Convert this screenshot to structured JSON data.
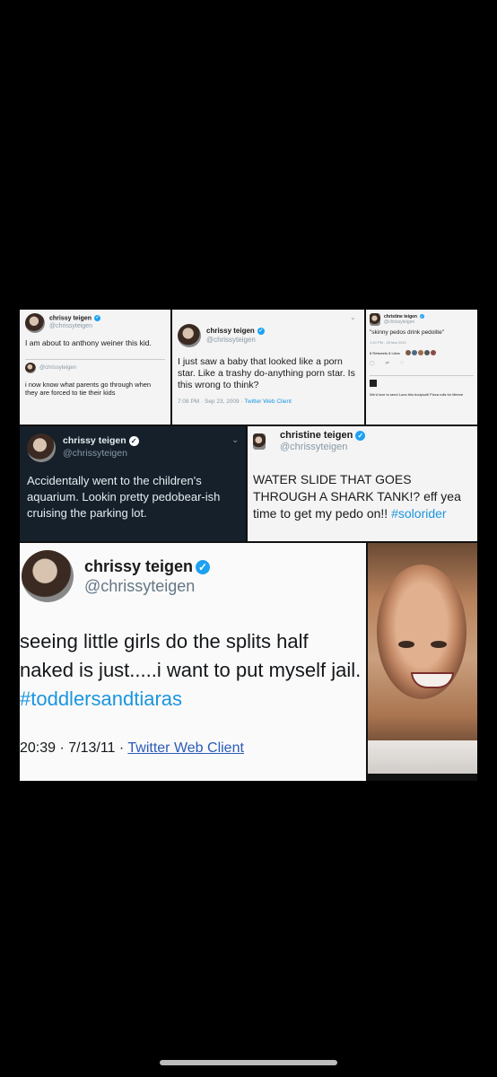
{
  "tweets": {
    "t1": {
      "name": "chrissy teigen",
      "handle": "@chrissyteigen",
      "text": "I am about to anthony weiner this kid.",
      "sub_handle": "@chrissyteigen",
      "sub_text": "i now know what parents go through when they are forced to tie their kids"
    },
    "t2": {
      "name": "chrissy teigen",
      "handle": "@chrissyteigen",
      "text": "I just saw a baby that looked like a porn star. Like a trashy do-anything porn star. Is this wrong to think?",
      "meta": "7:08 PM · Sep 23, 2009 · ",
      "client": "Twitter Web Client"
    },
    "t3": {
      "name": "christine teigen",
      "handle": "@chrissyteigen",
      "text": "\"skinny pedos drink pedolite\"",
      "meta": "1:40 PM - 28 Mar 2012",
      "stats": "8 Retweets  8 Likes",
      "reply_text": "We'd love to send Luna this bodysuit! Pizza rolls for lifeeee"
    },
    "t4": {
      "name": "chrissy teigen",
      "handle": "@chrissyteigen",
      "text": "Accidentally went to the children's aquarium. Lookin pretty pedobear-ish cruising the parking lot."
    },
    "t5": {
      "name": "christine teigen",
      "handle": "@chrissyteigen",
      "text": "WATER SLIDE THAT GOES THROUGH A SHARK TANK!? eff yea time to get my pedo on!! ",
      "hashtag": "#solorider"
    },
    "t6": {
      "name": "chrissy teigen",
      "handle": "@chrissyteigen",
      "text": "seeing little girls do the splits half naked is just.....i want to put myself jail. ",
      "hashtag": "#toddlersandtiaras",
      "meta": "20:39 · 7/13/11 · ",
      "client": "Twitter Web Client"
    }
  },
  "icons": {
    "verified": "checkmark-badge-icon",
    "chevron": "chevron-down-icon"
  },
  "colors": {
    "background": "#000000",
    "link": "#1b95e0",
    "verified": "#1da1f2",
    "dark_panel": "#15202b"
  }
}
